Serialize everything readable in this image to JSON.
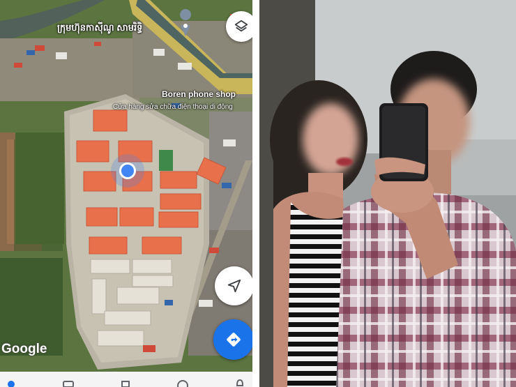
{
  "map": {
    "place_label_khmer": "ក្រុមហ៊ុនកាស៊ីណូ សាមរិទ្ធិ",
    "poi_name": "Boren phone shop",
    "poi_subtitle": "Cửa hàng sửa chữa điện thoại di động",
    "attribution": "Google",
    "icons": {
      "layers": "layers-icon",
      "compass": "navigate-arrow-icon",
      "directions": "directions-icon",
      "place_pin": "place-pin-icon"
    },
    "bottom_nav_icons": [
      "explore-icon",
      "commute-icon",
      "saved-icon",
      "contribute-icon",
      "updates-icon"
    ],
    "colors": {
      "accent_blue": "#1a73e8",
      "roof_orange": "#e8704a",
      "vegetation": "#4f6b3c"
    }
  },
  "photo": {
    "content": "mirror-selfie-photo"
  }
}
